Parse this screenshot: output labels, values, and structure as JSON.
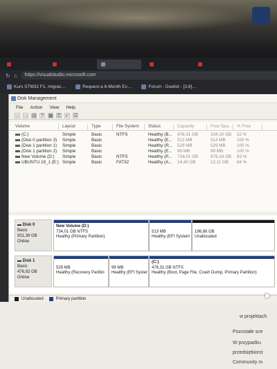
{
  "browser": {
    "tabs": [
      {
        "label": "",
        "active": false
      },
      {
        "label": "",
        "active": false
      },
      {
        "label": "",
        "active": true
      },
      {
        "label": "",
        "active": false
      },
      {
        "label": "",
        "active": false
      }
    ],
    "url": "https://visualstudio.microsoft.com",
    "bookmarks": [
      {
        "label": "Kurs STM32 F1, migrac…",
        "icon": "bookmark-icon"
      },
      {
        "label": "Request a 6-Month Ev…",
        "icon": "bookmark-icon"
      },
      {
        "label": "Forum - Duelist - [3.6]…",
        "icon": "bookmark-icon"
      }
    ]
  },
  "window": {
    "title": "Disk Management",
    "menu": [
      "File",
      "Action",
      "View",
      "Help"
    ],
    "columns": [
      "Volume",
      "Layout",
      "Type",
      "File System",
      "Status",
      "Capacity",
      "Free Spa...",
      "% Free"
    ],
    "volumes": [
      {
        "volume": "(C:)",
        "layout": "Simple",
        "type": "Basic",
        "fs": "NTFS",
        "status": "Healthy (B...",
        "capacity": "476,31 GB",
        "free": "104,10 GB",
        "pct": "22 %"
      },
      {
        "volume": "(Disk 0 partition 3)",
        "layout": "Simple",
        "type": "Basic",
        "fs": "",
        "status": "Healthy (E...",
        "capacity": "513 MB",
        "free": "513 MB",
        "pct": "100 %"
      },
      {
        "volume": "(Disk 1 partition 1)",
        "layout": "Simple",
        "type": "Basic",
        "fs": "",
        "status": "Healthy (R...",
        "capacity": "529 MB",
        "free": "529 MB",
        "pct": "100 %"
      },
      {
        "volume": "(Disk 1 partition 2)",
        "layout": "Simple",
        "type": "Basic",
        "fs": "",
        "status": "Healthy (E...",
        "capacity": "99 MB",
        "free": "99 MB",
        "pct": "100 %"
      },
      {
        "volume": "New Volume (D:)",
        "layout": "Simple",
        "type": "Basic",
        "fs": "NTFS",
        "status": "Healthy (P...",
        "capacity": "734,01 GB",
        "free": "679,18 GB",
        "pct": "93 %"
      },
      {
        "volume": "UBUNTU 19_1 (E:)",
        "layout": "Simple",
        "type": "Basic",
        "fs": "FAT32",
        "status": "Healthy (A...",
        "capacity": "14,40 GB",
        "free": "12,11 GB",
        "pct": "84 %"
      }
    ],
    "disks": [
      {
        "name": "Disk 0",
        "type": "Basic",
        "size": "931,39 GB",
        "state": "Online",
        "partitions": [
          {
            "title": "New Volume  (D:)",
            "line2": "734,01 GB NTFS",
            "line3": "Healthy (Primary Partition)",
            "kind": "primary"
          },
          {
            "title": "",
            "line2": "513 MB",
            "line3": "Healthy (EFI System",
            "kind": "primary"
          },
          {
            "title": "",
            "line2": "196,88 GB",
            "line3": "Unallocated",
            "kind": "unallocated"
          }
        ]
      },
      {
        "name": "Disk 1",
        "type": "Basic",
        "size": "476,92 GB",
        "state": "Online",
        "partitions": [
          {
            "title": "",
            "line2": "529 MB",
            "line3": "Healthy (Recovery Partitio",
            "kind": "primary"
          },
          {
            "title": "",
            "line2": "99 MB",
            "line3": "Healthy (EFI Syster",
            "kind": "primary"
          },
          {
            "title": "(C:)",
            "line2": "476,31 GB NTFS",
            "line3": "Healthy (Boot, Page File, Crash Dump, Primary Partition)",
            "kind": "primary"
          }
        ]
      }
    ],
    "legend": {
      "unallocated": "Unallocated",
      "primary": "Primary partition"
    },
    "colors": {
      "primary_bar": "#1b3f87",
      "unallocated_bar": "#1a1a1a"
    }
  },
  "webpage": {
    "lines": [
      "w projektach",
      "Pozostałe sce",
      "W przypadku",
      "przedsiębiorst",
      "Community m"
    ]
  }
}
